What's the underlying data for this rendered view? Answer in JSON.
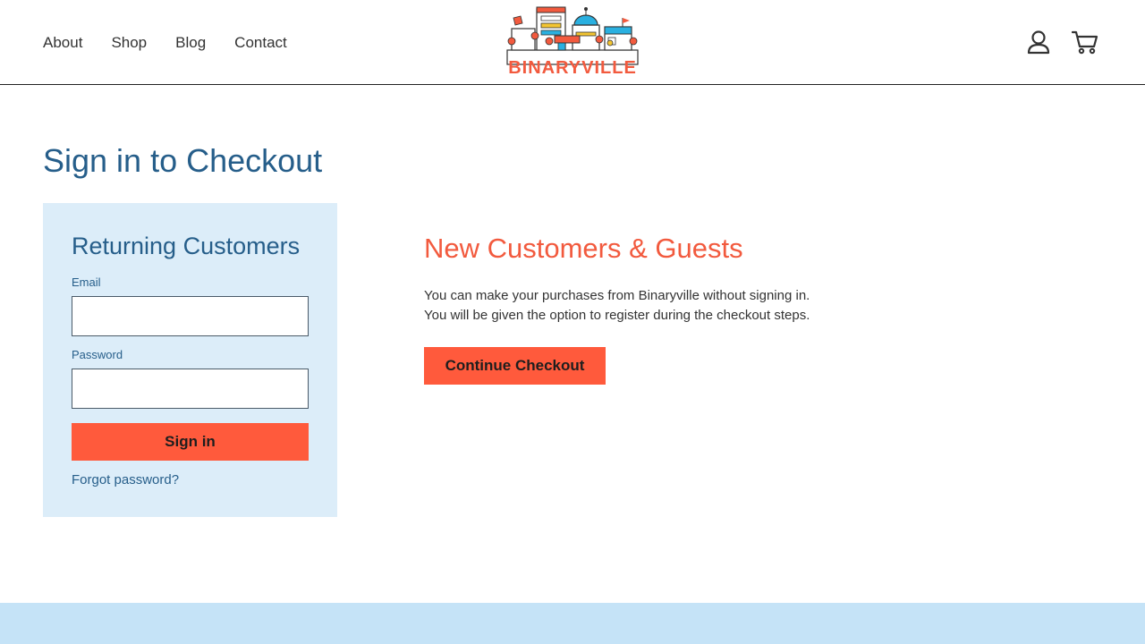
{
  "nav": {
    "items": [
      {
        "label": "About"
      },
      {
        "label": "Shop"
      },
      {
        "label": "Blog"
      },
      {
        "label": "Contact"
      }
    ]
  },
  "logo": {
    "text": "BINARYVILLE",
    "colors": {
      "red": "#f25a3e",
      "blue": "#2ab0e0",
      "yellow": "#f3c531",
      "outline": "#333333"
    }
  },
  "header_icons": {
    "account": "user-icon",
    "cart": "cart-icon"
  },
  "page": {
    "title": "Sign in to Checkout"
  },
  "returning": {
    "heading": "Returning Customers",
    "email_label": "Email",
    "email_value": "",
    "password_label": "Password",
    "password_value": "",
    "signin_label": "Sign in",
    "forgot_label": "Forgot password?"
  },
  "guests": {
    "heading": "New Customers & Guests",
    "line1": "You can make your purchases from Binaryville without signing in.",
    "line2": "You will be given the option to register during the checkout steps.",
    "continue_label": "Continue Checkout"
  },
  "colors": {
    "primary_blue": "#265e8a",
    "accent_orange": "#ff5a3c",
    "panel_bg": "#dcedf9",
    "footer_bg": "#c5e3f7"
  }
}
